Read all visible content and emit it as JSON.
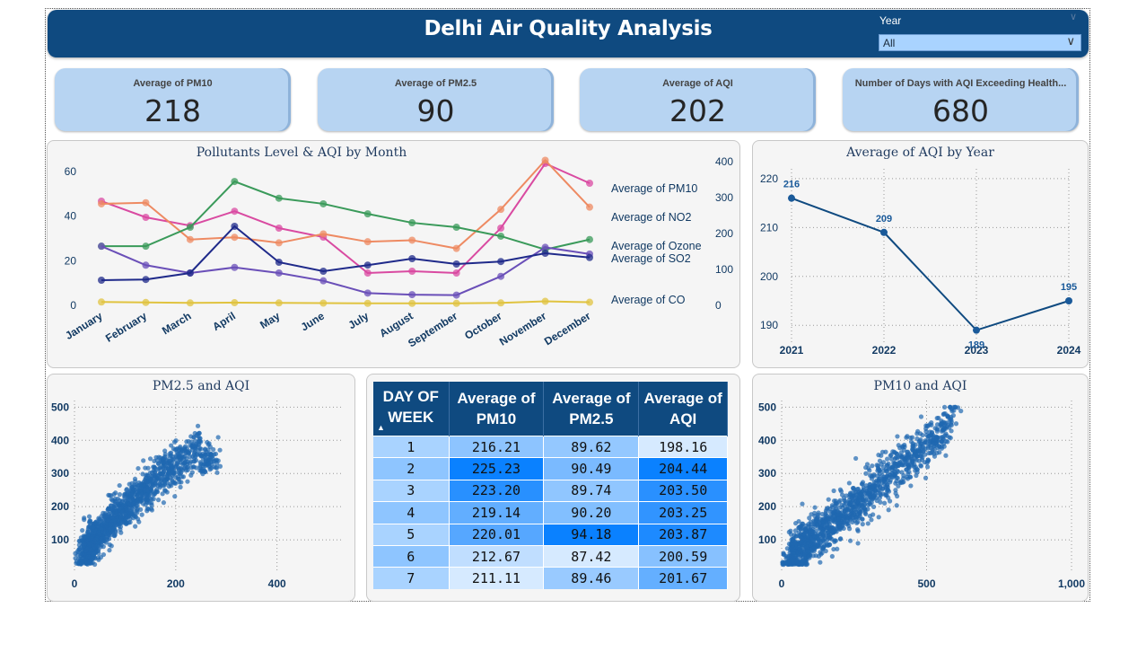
{
  "header": {
    "title": "Delhi Air Quality Analysis"
  },
  "slicer": {
    "label": "Year",
    "value": "All"
  },
  "kpis": [
    {
      "label": "Average of PM10",
      "value": "218"
    },
    {
      "label": "Average of PM2.5",
      "value": "90"
    },
    {
      "label": "Average of AQI",
      "value": "202"
    },
    {
      "label": "Number of Days with AQI Exceeding Health...",
      "value": "680"
    }
  ],
  "colors": {
    "header": "#0f4a80",
    "kpi_bg": "#b7d4f2",
    "accent": "#1a5a9a"
  },
  "chart_data": [
    {
      "type": "line",
      "title": "Pollutants Level & AQI by Month",
      "categories": [
        "January",
        "February",
        "March",
        "April",
        "May",
        "June",
        "July",
        "August",
        "September",
        "October",
        "November",
        "December"
      ],
      "y_left": {
        "ticks": [
          0,
          20,
          40,
          60
        ],
        "range": [
          0,
          66
        ]
      },
      "y_right": {
        "ticks": [
          0,
          100,
          200,
          300,
          400
        ],
        "range": [
          0,
          410
        ]
      },
      "legend_position": "right",
      "series": [
        {
          "name": "Average of PM10",
          "axis": "right",
          "color": "#d94aa1",
          "values": [
            290,
            245,
            222,
            262,
            215,
            190,
            90,
            95,
            90,
            215,
            395,
            340
          ]
        },
        {
          "name": "Average of NO2",
          "axis": "left",
          "color": "#ee8a62",
          "values": [
            45.5,
            46,
            29.5,
            30.5,
            28,
            32,
            28.5,
            29.2,
            25.5,
            43,
            65,
            44
          ]
        },
        {
          "name": "Average of Ozone",
          "axis": "left",
          "color": "#3a9a5a",
          "values": [
            26.5,
            26.5,
            35,
            55.5,
            48,
            45.5,
            41,
            37,
            35,
            31,
            25,
            29.5
          ]
        },
        {
          "name": "Average of SO2",
          "axis": "left",
          "color": "#6a4fb8",
          "values": [
            26.5,
            18,
            14.5,
            17,
            14.5,
            11,
            5.5,
            4.8,
            4.6,
            13,
            26,
            23
          ]
        },
        {
          "name": "AQI",
          "axis": "right",
          "color": "#1f2a8a",
          "values": [
            70,
            72,
            90,
            220,
            120,
            95,
            112,
            130,
            115,
            122,
            145,
            133
          ]
        },
        {
          "name": "Average of CO",
          "axis": "left",
          "color": "#e0c340",
          "values": [
            1.5,
            1.3,
            1.1,
            1.2,
            1.1,
            1.0,
            0.9,
            0.9,
            0.9,
            1.1,
            1.8,
            1.4
          ]
        }
      ]
    },
    {
      "type": "line",
      "title": "Average of AQI by Year",
      "x": [
        "2021",
        "2022",
        "2023",
        "2024"
      ],
      "values": [
        216,
        209,
        189,
        195
      ],
      "data_labels": [
        "216",
        "209",
        "189",
        "195"
      ],
      "y_ticks": [
        190,
        200,
        210,
        220
      ],
      "ylim": [
        186,
        222
      ],
      "grid": true
    },
    {
      "type": "scatter",
      "title": "PM2.5 and AQI",
      "x_ticks": [
        "0",
        "200",
        "400"
      ],
      "y_ticks": [
        "100",
        "200",
        "300",
        "400",
        "500"
      ],
      "xlim": [
        0,
        530
      ],
      "ylim": [
        0,
        520
      ],
      "grid": true
    },
    {
      "type": "scatter",
      "title": "PM10 and AQI",
      "x_ticks": [
        "0",
        "500",
        "1,000"
      ],
      "y_ticks": [
        "100",
        "200",
        "300",
        "400",
        "500"
      ],
      "xlim": [
        0,
        1000
      ],
      "ylim": [
        0,
        520
      ],
      "grid": true
    },
    {
      "type": "table",
      "columns": [
        "DAY OF WEEK",
        "Average of PM10",
        "Average of PM2.5",
        "Average of AQI"
      ],
      "rows": [
        [
          "1",
          "216.21",
          "89.62",
          "198.16"
        ],
        [
          "2",
          "225.23",
          "90.49",
          "204.44"
        ],
        [
          "3",
          "223.20",
          "89.74",
          "203.50"
        ],
        [
          "4",
          "219.14",
          "90.20",
          "203.25"
        ],
        [
          "5",
          "220.01",
          "94.18",
          "203.87"
        ],
        [
          "6",
          "212.67",
          "87.42",
          "200.59"
        ],
        [
          "7",
          "211.11",
          "89.46",
          "201.67"
        ]
      ]
    }
  ]
}
